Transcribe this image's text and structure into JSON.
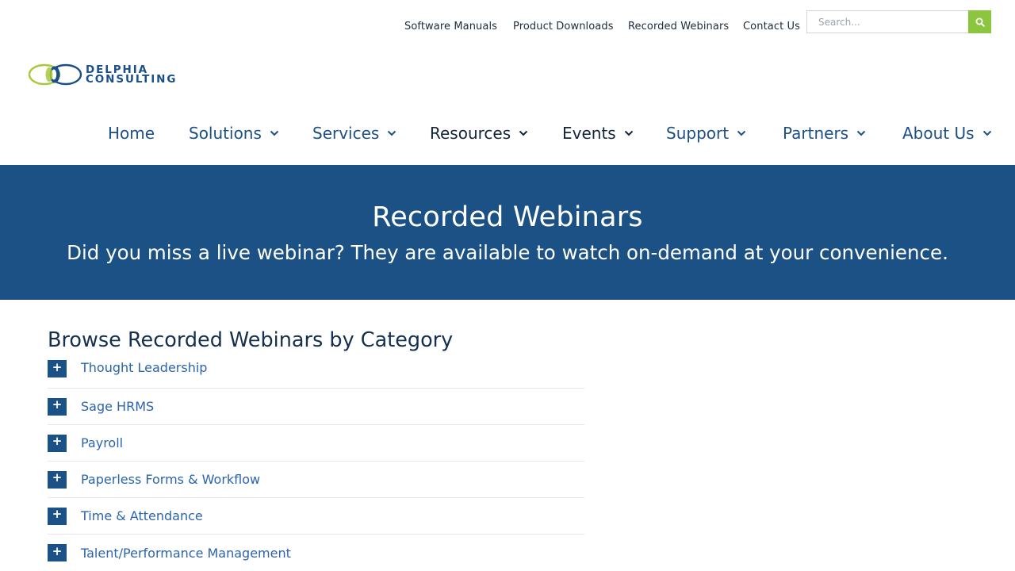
{
  "utility_nav": [
    "Software Manuals",
    "Product Downloads",
    "Recorded Webinars",
    "Contact Us"
  ],
  "search": {
    "placeholder": "Search...",
    "button_icon": "search-icon"
  },
  "logo": {
    "line1": "DELPHIA",
    "line2": "CONSULTING",
    "colors": {
      "green": "#a6c93a",
      "blue": "#1b4f8a"
    }
  },
  "main_nav": [
    {
      "label": "Home"
    },
    {
      "label": "Solutions",
      "icon": "chevron-down-icon"
    },
    {
      "label": "Services",
      "icon": "chevron-down-icon"
    },
    {
      "label": "Resources",
      "icon": "chevron-down-icon"
    },
    {
      "label": "Events",
      "icon": "chevron-down-icon"
    },
    {
      "label": "Support",
      "icon": "chevron-down-icon"
    },
    {
      "label": "Partners",
      "icon": "chevron-down-icon"
    },
    {
      "label": "About Us",
      "icon": "chevron-down-icon"
    }
  ],
  "banner": {
    "title": "Recorded Webinars",
    "subtitle": "Did you miss a live webinar? They are available to watch on-demand at your convenience."
  },
  "categories": {
    "heading": "Browse Recorded Webinars by Category",
    "toggle_symbol": "+",
    "items": [
      "Thought Leadership",
      "Sage HRMS",
      "Payroll",
      "Paperless Forms & Workflow",
      "Time & Attendance",
      "Talent/Performance Management"
    ]
  },
  "colors": {
    "brand_blue": "#1c5185",
    "accent_green": "#8cc63f",
    "link_blue": "#2b64ad"
  }
}
